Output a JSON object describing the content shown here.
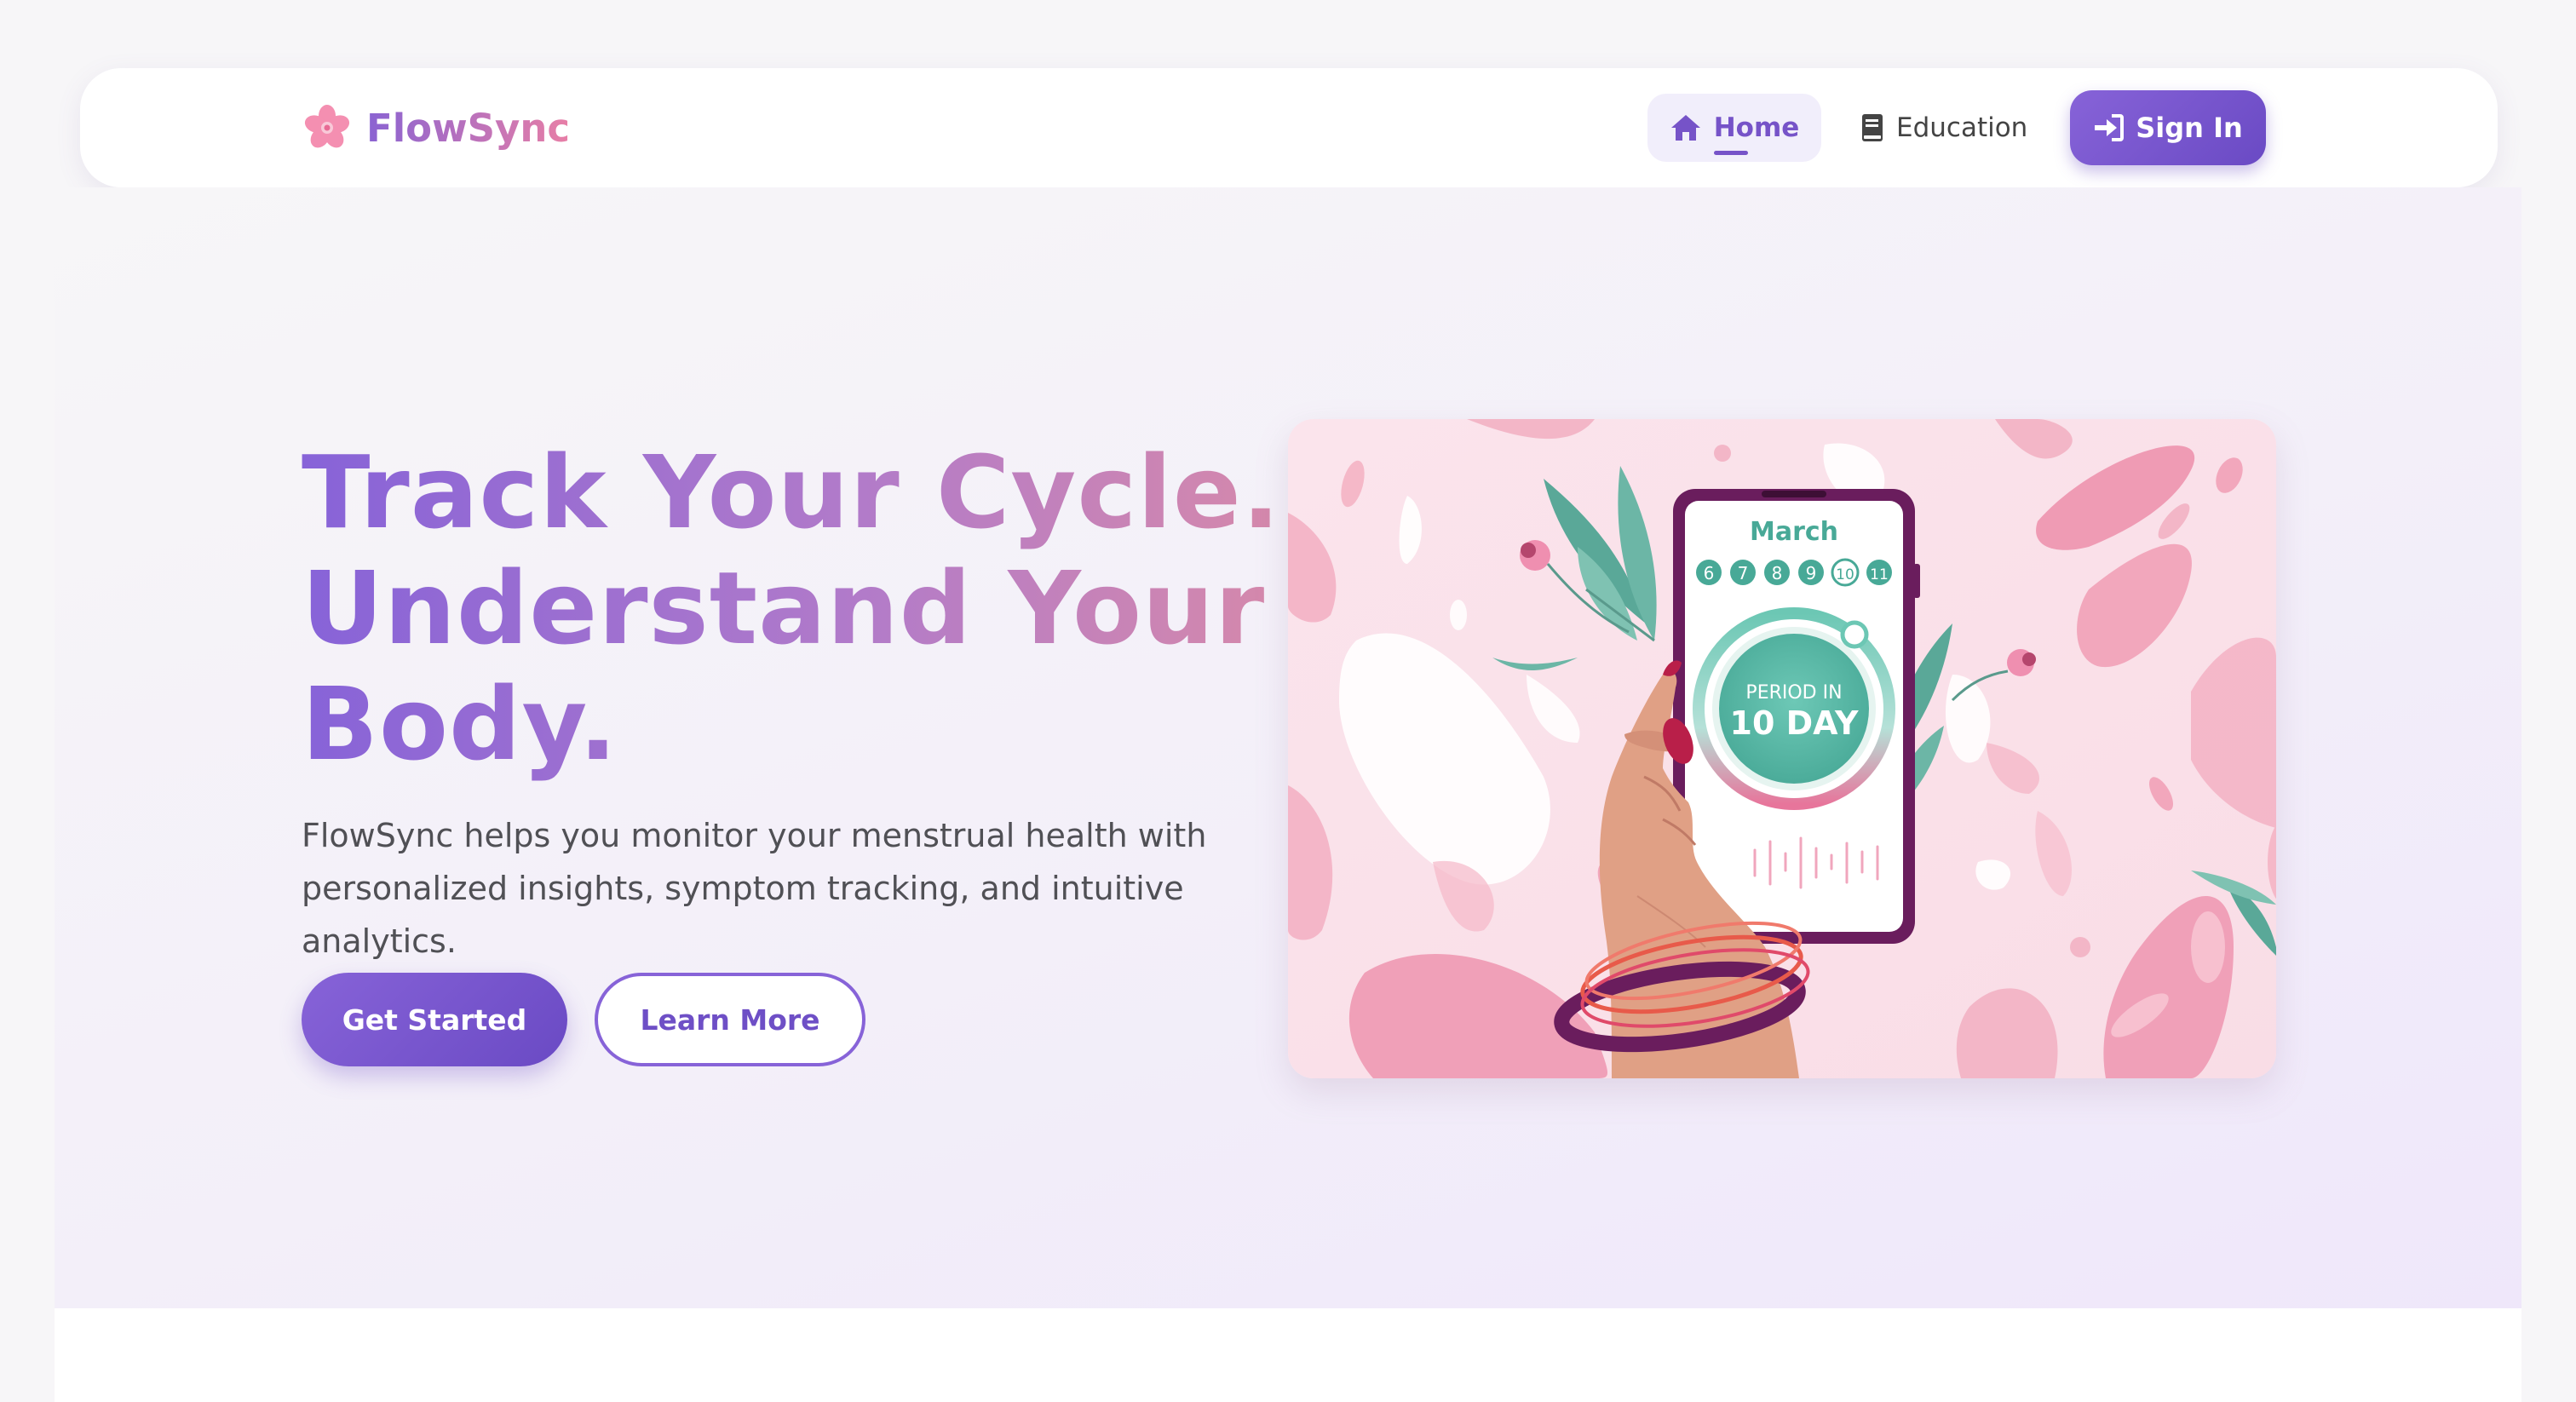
{
  "brand": {
    "name": "FlowSync",
    "icon": "cherry-blossom-icon"
  },
  "nav": {
    "items": [
      {
        "label": "Home",
        "icon": "home-icon",
        "active": true
      },
      {
        "label": "Education",
        "icon": "book-icon",
        "active": false
      }
    ],
    "signin": {
      "label": "Sign In",
      "icon": "sign-in-icon"
    }
  },
  "hero": {
    "title_lines": [
      "Track Your Cycle.",
      "Understand Your",
      "Body."
    ],
    "subtitle": "FlowSync helps you monitor your menstrual health with personalized insights, symptom tracking, and intuitive analytics.",
    "primary_button": "Get Started",
    "secondary_button": "Learn More"
  },
  "illustration": {
    "month": "March",
    "days": [
      "6",
      "7",
      "8",
      "9",
      "10",
      "11"
    ],
    "status_line1": "PERIOD IN",
    "status_line2": "10 DAY"
  },
  "colors": {
    "accent": "#7653c8",
    "gradient_start": "#8763d8",
    "gradient_end": "#e87fa6",
    "teal": "#4fb0a0",
    "pink": "#f2a7bc"
  }
}
